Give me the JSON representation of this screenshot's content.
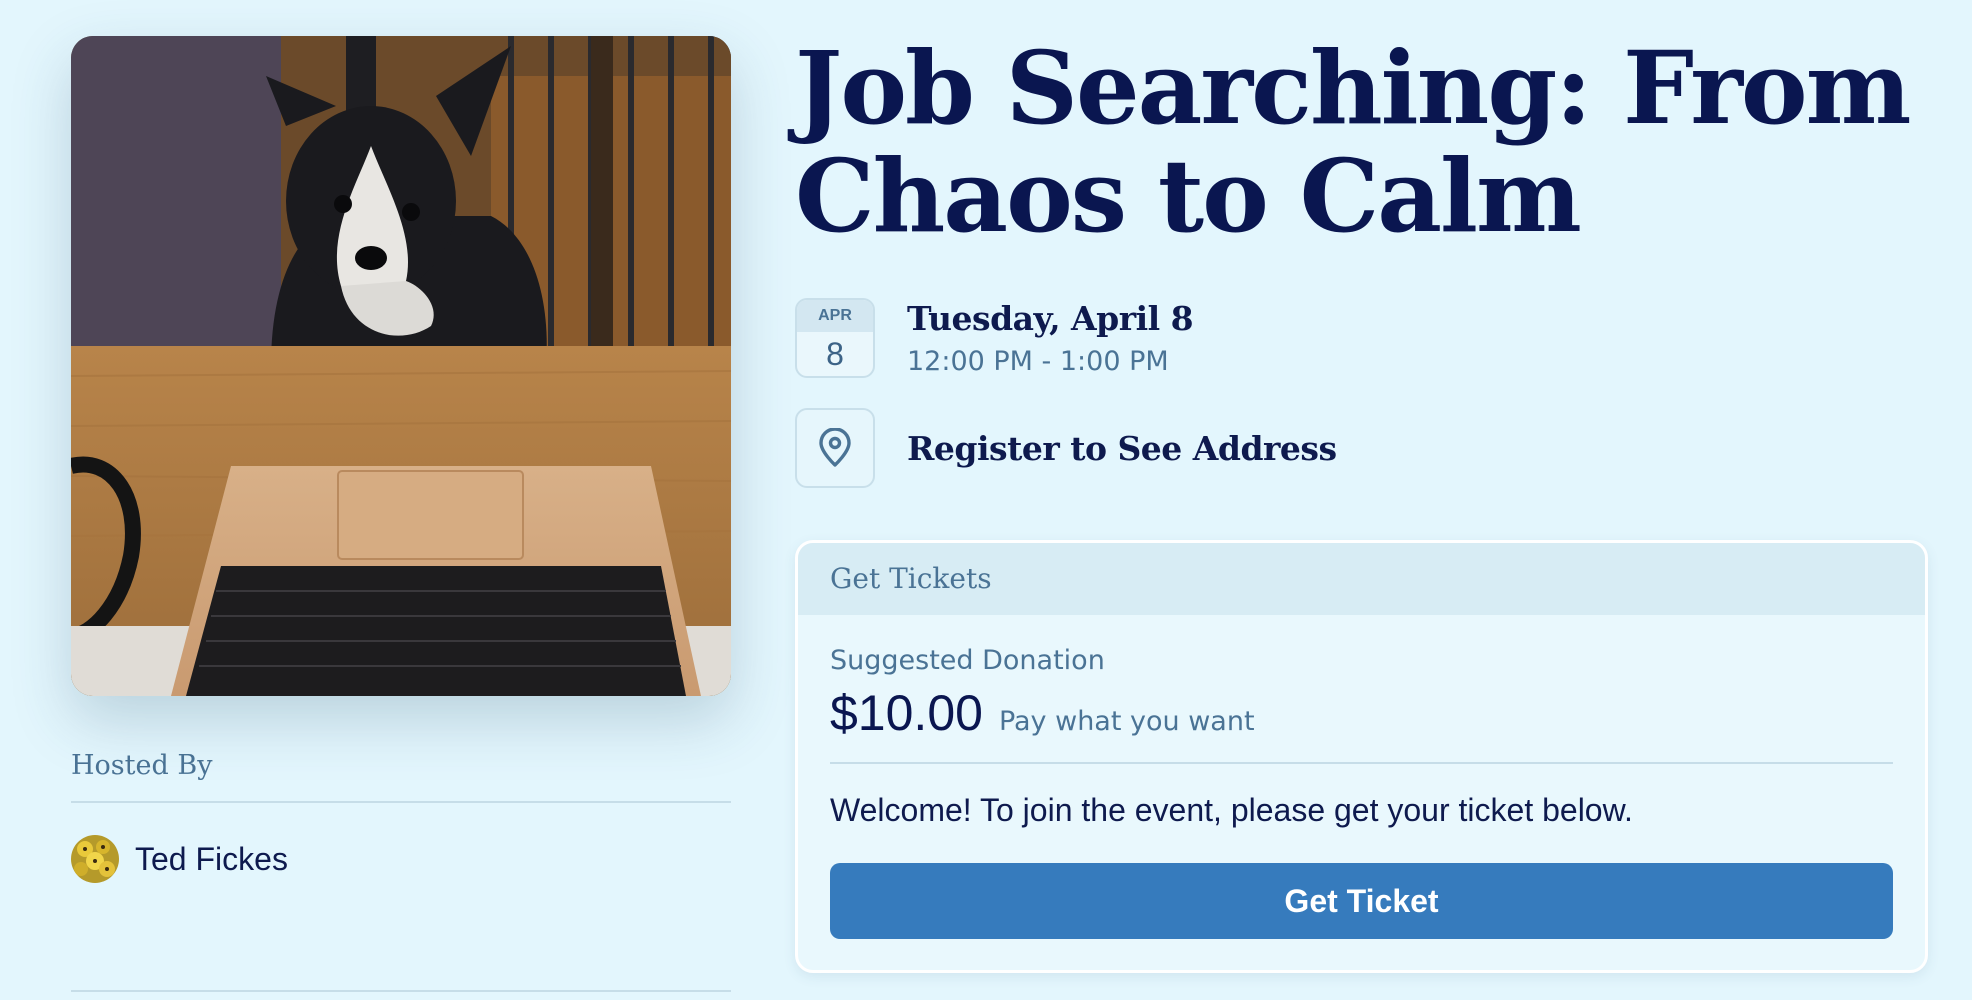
{
  "event": {
    "title": "Job Searching: From Chaos to Calm",
    "cover_image": "dog-with-laptop-photo",
    "date_badge": {
      "month": "APR",
      "day": "8"
    },
    "date_text": "Tuesday, April 8",
    "time_text": "12:00 PM - 1:00 PM",
    "location_text": "Register to See Address",
    "location_icon": "map-pin-icon"
  },
  "host": {
    "label": "Hosted By",
    "name": "Ted Fickes",
    "avatar": "host-avatar-image"
  },
  "tickets": {
    "header": "Get Tickets",
    "suggested_label": "Suggested Donation",
    "price": "$10.00",
    "price_note": "Pay what you want",
    "welcome": "Welcome! To join the event, please get your ticket below.",
    "button_label": "Get Ticket"
  },
  "colors": {
    "page_bg": "#e3f6fd",
    "title": "#0a1650",
    "muted": "#4a7395",
    "button": "#367bbd"
  }
}
